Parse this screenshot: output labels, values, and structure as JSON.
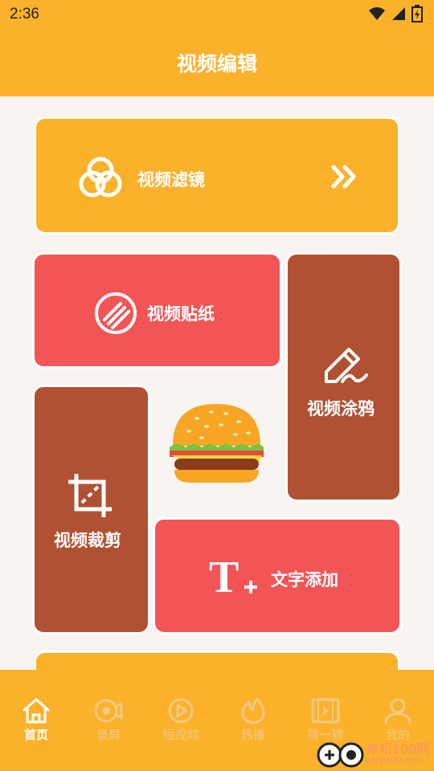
{
  "status_bar": {
    "time": "2:36",
    "icons": [
      "wifi-icon",
      "signal-icon",
      "battery-charging-icon"
    ]
  },
  "app_bar": {
    "title": "视频编辑"
  },
  "features": {
    "filter": {
      "label": "视频滤镜",
      "icon": "filter-circles-icon",
      "arrow": "double-chevron-right-icon"
    },
    "sticker": {
      "label": "视频贴纸",
      "icon": "sticker-icon"
    },
    "doodle": {
      "label": "视频涂鸦",
      "icon": "pencil-icon"
    },
    "crop": {
      "label": "视频裁剪",
      "icon": "crop-icon"
    },
    "text": {
      "label": "文字添加",
      "icon": "text-add-icon"
    }
  },
  "decoration": {
    "icon": "burger-icon"
  },
  "tabs": [
    {
      "label": "首页",
      "icon": "home-icon",
      "active": true
    },
    {
      "label": "录屏",
      "icon": "screen-record-icon",
      "active": false
    },
    {
      "label": "短视频",
      "icon": "play-circle-icon",
      "active": false
    },
    {
      "label": "热播",
      "icon": "flame-icon",
      "active": false
    },
    {
      "label": "猜一猜",
      "icon": "film-icon",
      "active": false
    },
    {
      "label": "我的",
      "icon": "user-icon",
      "active": false
    }
  ],
  "watermark": {
    "text": "单机100网",
    "url": "danji100.com"
  },
  "colors": {
    "primary": "#fbb12a",
    "red_card": "#f35557",
    "brown_card": "#b05133",
    "background": "#f8f4f2"
  }
}
